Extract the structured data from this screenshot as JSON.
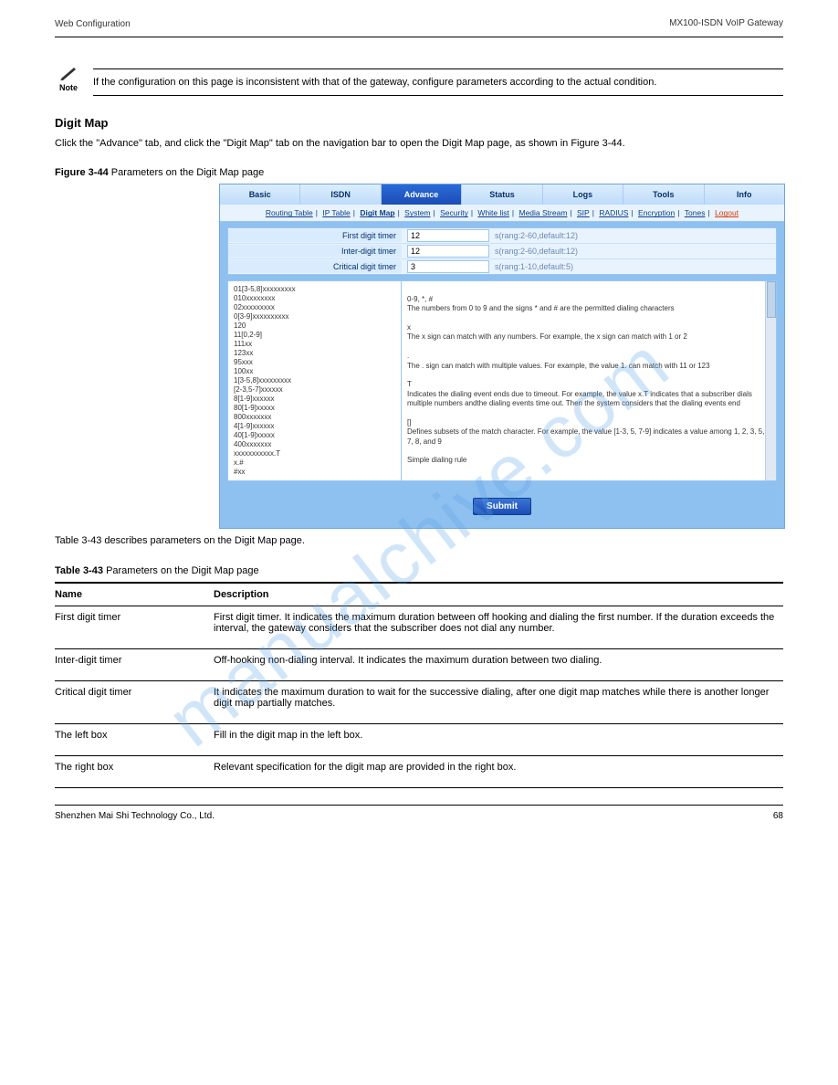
{
  "header": {
    "left": "Web Configuration",
    "right": "MX100-ISDN VoIP Gateway"
  },
  "note": {
    "icon_label": "Note",
    "text": "If the configuration on this page is inconsistent with that of the gateway, configure parameters according to the actual condition."
  },
  "section": {
    "title": "Digit Map",
    "intro": "Click the \"Advance\" tab, and click the \"Digit Map\" tab on the navigation bar to open the Digit Map page, as shown in Figure 3-44.",
    "figure_caption_label": "Figure 3-44",
    "figure_caption_text": "Parameters on the Digit Map page",
    "outro": "Table 3-43 describes parameters on the Digit Map page.",
    "table_caption_label": "Table 3-43",
    "table_caption_text": "Parameters on the Digit Map page"
  },
  "screenshot": {
    "tabs": [
      "Basic",
      "ISDN",
      "Advance",
      "Status",
      "Logs",
      "Tools",
      "Info"
    ],
    "active_tab_index": 2,
    "subnav": [
      "Routing Table",
      "IP Table",
      "Digit Map",
      "System",
      "Security",
      "White list",
      "Media Stream",
      "SIP",
      "RADIUS",
      "Encryption",
      "Tones"
    ],
    "subnav_active_index": 2,
    "subnav_logout": "Logout",
    "rows": [
      {
        "label": "First digit timer",
        "value": "12",
        "hint": "s(rang:2-60,default:12)"
      },
      {
        "label": "Inter-digit timer",
        "value": "12",
        "hint": "s(rang:2-60,default:12)"
      },
      {
        "label": "Critical digit timer",
        "value": "3",
        "hint": "s(rang:1-10,default:5)"
      }
    ],
    "left_textarea": "01[3-5,8]xxxxxxxxx\n010xxxxxxxx\n02xxxxxxxxx\n0[3-9]xxxxxxxxxx\n120\n11[0,2-9]\n111xx\n123xx\n95xxx\n100xx\n1[3-5,8]xxxxxxxxx\n[2-3,5-7]xxxxxx\n8[1-9]xxxxxx\n80[1-9]xxxxx\n800xxxxxxx\n4[1-9]xxxxxx\n40[1-9]xxxxx\n400xxxxxxx\nxxxxxxxxxxx.T\nx.#\n#xx",
    "right_textarea": "0-9, *, #\nThe numbers from 0 to 9 and the signs * and # are the permitted dialing characters\n\nx\nThe x sign can match with any numbers. For example, the x sign can match with 1 or 2\n\n.\nThe . sign can match with multiple values. For example, the value 1. can match with 11 or 123\n\nT\nIndicates the dialing event ends due to timeout. For example, the value x.T indicates that a subscriber dials multiple numbers andthe dialing events time out. Then the system considers that the dialing events end\n\n[]\nDefines subsets of the match character. For example, the value [1-3, 5, 7-9] indicates a value among 1, 2, 3, 5, 7, 8, and 9\n\nSimple dialing rule",
    "submit_label": "Submit"
  },
  "param_table": {
    "headers": [
      "Name",
      "Description"
    ],
    "rows": [
      {
        "name": "First digit timer",
        "desc": "First digit timer. It indicates the maximum duration between off hooking and dialing the first number. If the duration exceeds the interval, the gateway considers that the subscriber does not dial any number."
      },
      {
        "name": "Inter-digit timer",
        "desc": "Off-hooking non-dialing interval. It indicates the maximum duration between two dialing."
      },
      {
        "name": "Critical digit timer",
        "desc": "It indicates the maximum duration to wait for the successive dialing, after one digit map matches while there is another longer digit map partially matches."
      },
      {
        "name": "The left box",
        "desc": "Fill in the digit map in the left box."
      },
      {
        "name": "The right box",
        "desc": "Relevant specification for the digit map are provided in the right box."
      }
    ]
  },
  "footer": {
    "left": "Shenzhen Mai Shi Technology Co., Ltd.",
    "right": "68"
  },
  "watermark": "manualchive.com"
}
